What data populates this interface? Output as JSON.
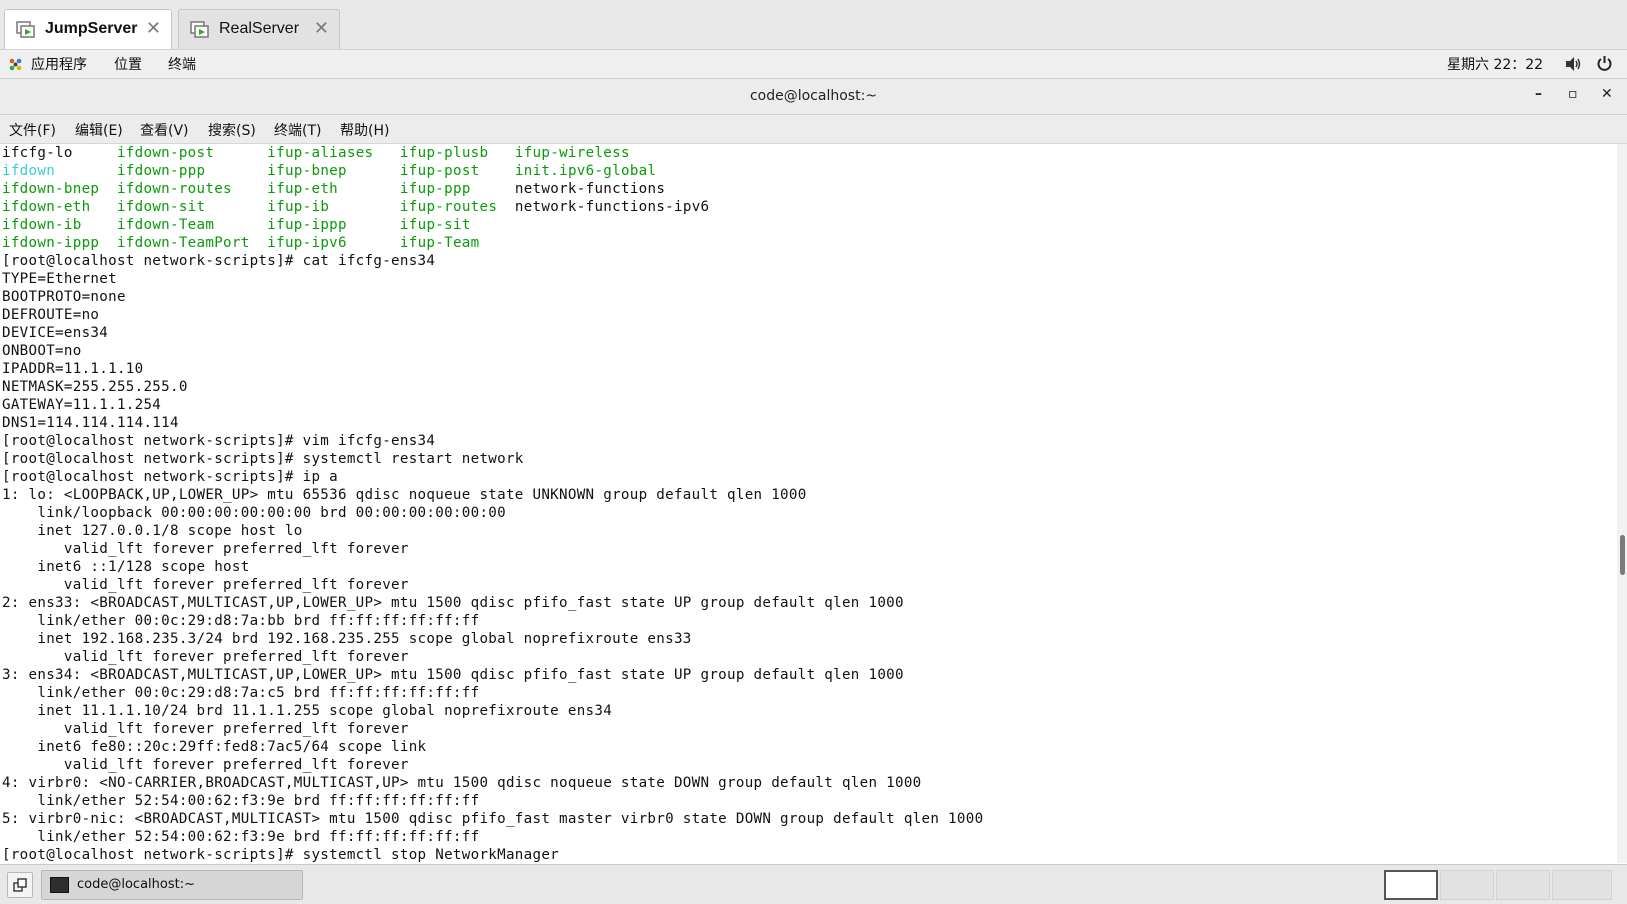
{
  "vm_tabs": [
    {
      "label": "JumpServer",
      "active": true,
      "close": "✕"
    },
    {
      "label": "RealServer",
      "active": false,
      "close": "✕"
    }
  ],
  "topbar": {
    "applications": "应用程序",
    "places": "位置",
    "terminal": "终端",
    "clock": "星期六 22：22"
  },
  "window": {
    "title": "code@localhost:~",
    "minimize": "–",
    "maximize": "▫",
    "close": "✕"
  },
  "menubar": [
    "文件(F)",
    "编辑(E)",
    "查看(V)",
    "搜索(S)",
    "终端(T)",
    "帮助(H)"
  ],
  "terminal": {
    "ls_rows": [
      [
        "ifcfg-lo",
        "ifdown-post",
        "ifup-aliases",
        "ifup-plusb",
        "ifup-wireless"
      ],
      [
        "ifdown",
        "ifdown-ppp",
        "ifup-bnep",
        "ifup-post",
        "init.ipv6-global"
      ],
      [
        "ifdown-bnep",
        "ifdown-routes",
        "ifup-eth",
        "ifup-ppp",
        "network-functions"
      ],
      [
        "ifdown-eth",
        "ifdown-sit",
        "ifup-ib",
        "ifup-routes",
        "network-functions-ipv6"
      ],
      [
        "ifdown-ib",
        "ifdown-Team",
        "ifup-ippp",
        "ifup-sit",
        ""
      ],
      [
        "ifdown-ippp",
        "ifdown-TeamPort",
        "ifup-ipv6",
        "ifup-Team",
        ""
      ]
    ],
    "lines": [
      "[root@localhost network-scripts]# cat ifcfg-ens34",
      "TYPE=Ethernet",
      "BOOTPROTO=none",
      "DEFROUTE=no",
      "DEVICE=ens34",
      "ONBOOT=no",
      "IPADDR=11.1.1.10",
      "NETMASK=255.255.255.0",
      "GATEWAY=11.1.1.254",
      "DNS1=114.114.114.114",
      "[root@localhost network-scripts]# vim ifcfg-ens34",
      "[root@localhost network-scripts]# systemctl restart network",
      "[root@localhost network-scripts]# ip a",
      "1: lo: <LOOPBACK,UP,LOWER_UP> mtu 65536 qdisc noqueue state UNKNOWN group default qlen 1000",
      "    link/loopback 00:00:00:00:00:00 brd 00:00:00:00:00:00",
      "    inet 127.0.0.1/8 scope host lo",
      "       valid_lft forever preferred_lft forever",
      "    inet6 ::1/128 scope host",
      "       valid_lft forever preferred_lft forever",
      "2: ens33: <BROADCAST,MULTICAST,UP,LOWER_UP> mtu 1500 qdisc pfifo_fast state UP group default qlen 1000",
      "    link/ether 00:0c:29:d8:7a:bb brd ff:ff:ff:ff:ff:ff",
      "    inet 192.168.235.3/24 brd 192.168.235.255 scope global noprefixroute ens33",
      "       valid_lft forever preferred_lft forever",
      "3: ens34: <BROADCAST,MULTICAST,UP,LOWER_UP> mtu 1500 qdisc pfifo_fast state UP group default qlen 1000",
      "    link/ether 00:0c:29:d8:7a:c5 brd ff:ff:ff:ff:ff:ff",
      "    inet 11.1.1.10/24 brd 11.1.1.255 scope global noprefixroute ens34",
      "       valid_lft forever preferred_lft forever",
      "    inet6 fe80::20c:29ff:fed8:7ac5/64 scope link",
      "       valid_lft forever preferred_lft forever",
      "4: virbr0: <NO-CARRIER,BROADCAST,MULTICAST,UP> mtu 1500 qdisc noqueue state DOWN group default qlen 1000",
      "    link/ether 52:54:00:62:f3:9e brd ff:ff:ff:ff:ff:ff",
      "5: virbr0-nic: <BROADCAST,MULTICAST> mtu 1500 qdisc pfifo_fast master virbr0 state DOWN group default qlen 1000",
      "    link/ether 52:54:00:62:f3:9e brd ff:ff:ff:ff:ff:ff",
      "[root@localhost network-scripts]# systemctl stop NetworkManager"
    ]
  },
  "taskbar": {
    "task_label": "code@localhost:~",
    "workspaces": 4,
    "active_workspace": 1
  },
  "colors": {
    "ls_green": "#0a9b0a",
    "ls_cyan": "#35cfd6"
  },
  "icons": {
    "tab": "vm-screen-icon",
    "apps": "applications-icon",
    "volume": "speaker-icon",
    "power": "power-icon",
    "show_desktop": "show-desktop-icon",
    "terminal": "terminal-icon"
  }
}
